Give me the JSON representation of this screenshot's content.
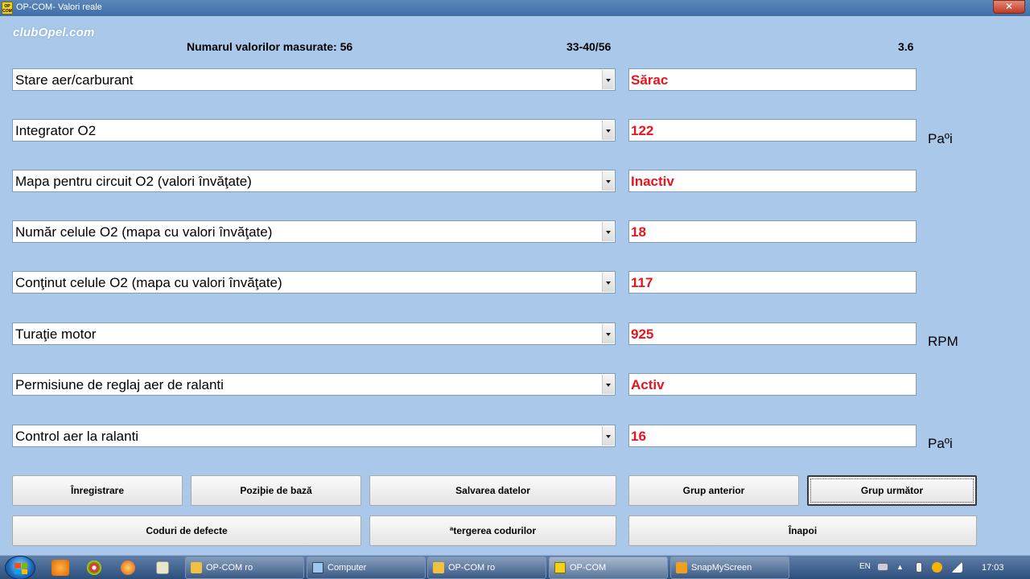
{
  "window": {
    "title": "OP-COM- Valori reale",
    "app_icon_text": "OP COM",
    "close_glyph": "✕"
  },
  "logo": {
    "text": "clubOpel.com"
  },
  "header": {
    "count_label": "Numarul valorilor masurate: 56",
    "range": "33-40/56",
    "version": "3.6"
  },
  "rows": [
    {
      "label": "Stare aer/carburant",
      "value": "Sărac",
      "unit": ""
    },
    {
      "label": "Integrator O2",
      "value": "122",
      "unit": "Paºi"
    },
    {
      "label": "Mapa pentru circuit O2 (valori învăţate)",
      "value": "Inactiv",
      "unit": ""
    },
    {
      "label": "Număr celule O2 (mapa cu valori învăţate)",
      "value": "18",
      "unit": ""
    },
    {
      "label": "Conţinut celule O2 (mapa cu valori învăţate)",
      "value": "117",
      "unit": ""
    },
    {
      "label": "Turaţie motor",
      "value": "925",
      "unit": "RPM"
    },
    {
      "label": "Permisiune de reglaj aer de ralanti",
      "value": "Activ",
      "unit": ""
    },
    {
      "label": "Control aer la ralanti",
      "value": "16",
      "unit": "Paºi"
    }
  ],
  "buttons": {
    "record": "Înregistrare",
    "base_position": "Poziþie de bază",
    "save_data": "Salvarea datelor",
    "prev_group": "Grup anterior",
    "next_group": "Grup următor",
    "fault_codes": "Coduri de defecte",
    "clear_codes": "ªtergerea codurilor",
    "back": "Înapoi"
  },
  "taskbar": {
    "tasks": [
      {
        "label": "OP-COM ro",
        "icon": "folder-icon"
      },
      {
        "label": "Computer",
        "icon": "computer-icon"
      },
      {
        "label": "OP-COM ro",
        "icon": "folder-icon"
      },
      {
        "label": "OP-COM",
        "icon": "opcom-icon"
      },
      {
        "label": "SnapMyScreen",
        "icon": "snapmyscreen-icon"
      }
    ],
    "language": "EN",
    "clock": "17:03"
  },
  "colors": {
    "value_text": "#e8141e",
    "background": "#a9c8ea"
  }
}
